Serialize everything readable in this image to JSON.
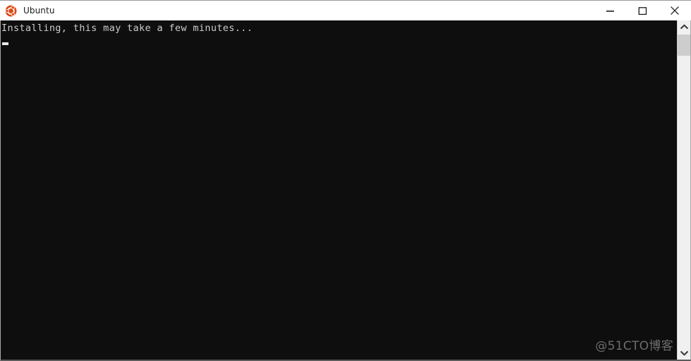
{
  "window": {
    "title": "Ubuntu",
    "app_icon": "ubuntu-logo-icon",
    "controls": {
      "minimize_label": "Minimize",
      "maximize_label": "Maximize",
      "close_label": "Close"
    }
  },
  "terminal": {
    "lines": [
      "Installing, this may take a few minutes..."
    ],
    "cursor_row": 2,
    "cursor_col": 1,
    "background_color": "#0e0e0e",
    "text_color": "#cccccc"
  },
  "watermark": {
    "text": "@51CTO博客"
  },
  "scrollbar": {
    "up_arrow": "chevron-up-icon",
    "down_arrow": "chevron-down-icon",
    "thumb_position_percent": 0,
    "track_color": "#f0f0f0",
    "thumb_color": "#cdcdcd"
  },
  "colors": {
    "titlebar_background": "#ffffff",
    "titlebar_text": "#1a1a1a",
    "ubuntu_orange": "#dd4814",
    "window_border": "#a8a8a8"
  }
}
